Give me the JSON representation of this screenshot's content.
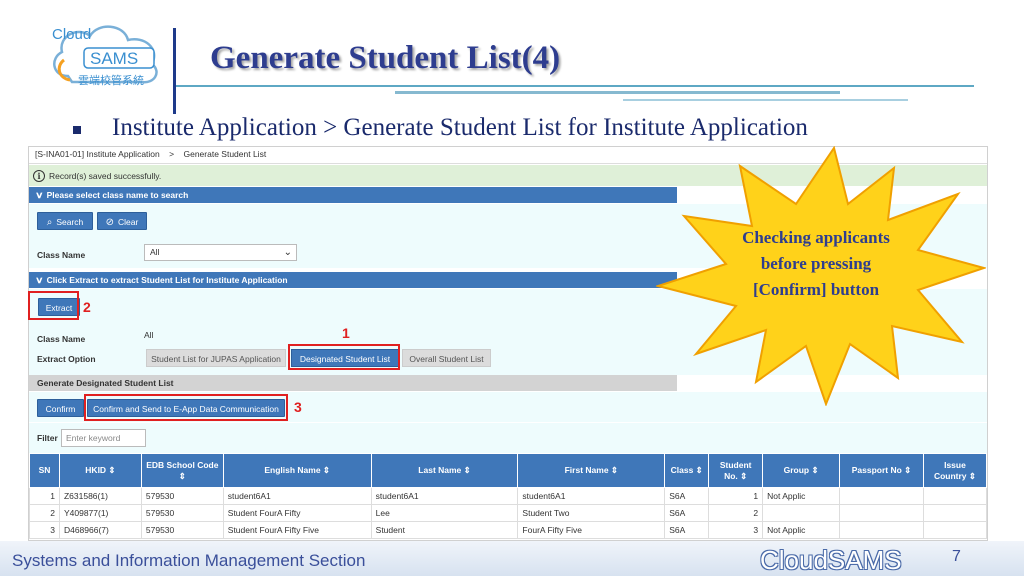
{
  "logo": {
    "line1": "Cloud",
    "line2": "SAMS",
    "line3": "雲端校管系統"
  },
  "slide": {
    "title": "Generate Student List(4)",
    "bullet": "Institute Application > Generate Student List for Institute Application"
  },
  "app": {
    "breadcrumb": {
      "code": "[S-INA01-01]",
      "item1": "Institute Application",
      "separator": ">",
      "item2": "Generate Student List"
    },
    "success_message": "Record(s) saved successfully.",
    "search_section": {
      "header": "Please select class name to search",
      "search_label": "Search",
      "clear_label": "Clear",
      "class_name_label": "Class Name",
      "class_name_value": "All"
    },
    "extract_section": {
      "header": "Click Extract to extract Student List for Institute Application",
      "extract_label": "Extract",
      "class_name_label": "Class Name",
      "class_name_value": "All",
      "extract_option_label": "Extract Option",
      "options": [
        "Student List for JUPAS Application",
        "Designated Student List",
        "Overall Student List"
      ]
    },
    "generate_section": {
      "header": "Generate Designated Student List",
      "confirm_label": "Confirm",
      "confirm_send_label": "Confirm and Send to E-App Data Communication"
    },
    "filter": {
      "label": "Filter",
      "placeholder": "Enter keyword"
    },
    "table": {
      "headers": [
        "SN",
        "HKID ⇕",
        "EDB School Code ⇕",
        "English Name ⇕",
        "Last Name ⇕",
        "First Name ⇕",
        "Class ⇕",
        "Student No. ⇕",
        "Group ⇕",
        "Passport No ⇕",
        "Issue Country ⇕"
      ],
      "rows": [
        [
          "1",
          "Z631586(1)",
          "579530",
          "student6A1",
          "student6A1",
          "student6A1",
          "S6A",
          "1",
          "Not Applic",
          "",
          ""
        ],
        [
          "2",
          "Y409877(1)",
          "579530",
          "Student FourA Fifty",
          "Lee",
          "Student Two",
          "S6A",
          "2",
          "",
          "",
          ""
        ],
        [
          "3",
          "D468966(7)",
          "579530",
          "Student FourA Fifty Five",
          "Student",
          "FourA Fifty Five",
          "S6A",
          "3",
          "Not Applic",
          "",
          ""
        ]
      ]
    }
  },
  "annotations": {
    "n1": "1",
    "n2": "2",
    "n3": "3"
  },
  "callout": {
    "text": "Checking applicants before pressing [Confirm] button"
  },
  "footer": {
    "section": "Systems and Information Management Section",
    "brand": "CloudSAMS",
    "page": "7"
  },
  "colors": {
    "accent": "#3f77b9",
    "title": "#2e3d8f",
    "annotation": "#e02020",
    "star_fill": "#ffd21a",
    "star_stroke": "#f0a000"
  }
}
